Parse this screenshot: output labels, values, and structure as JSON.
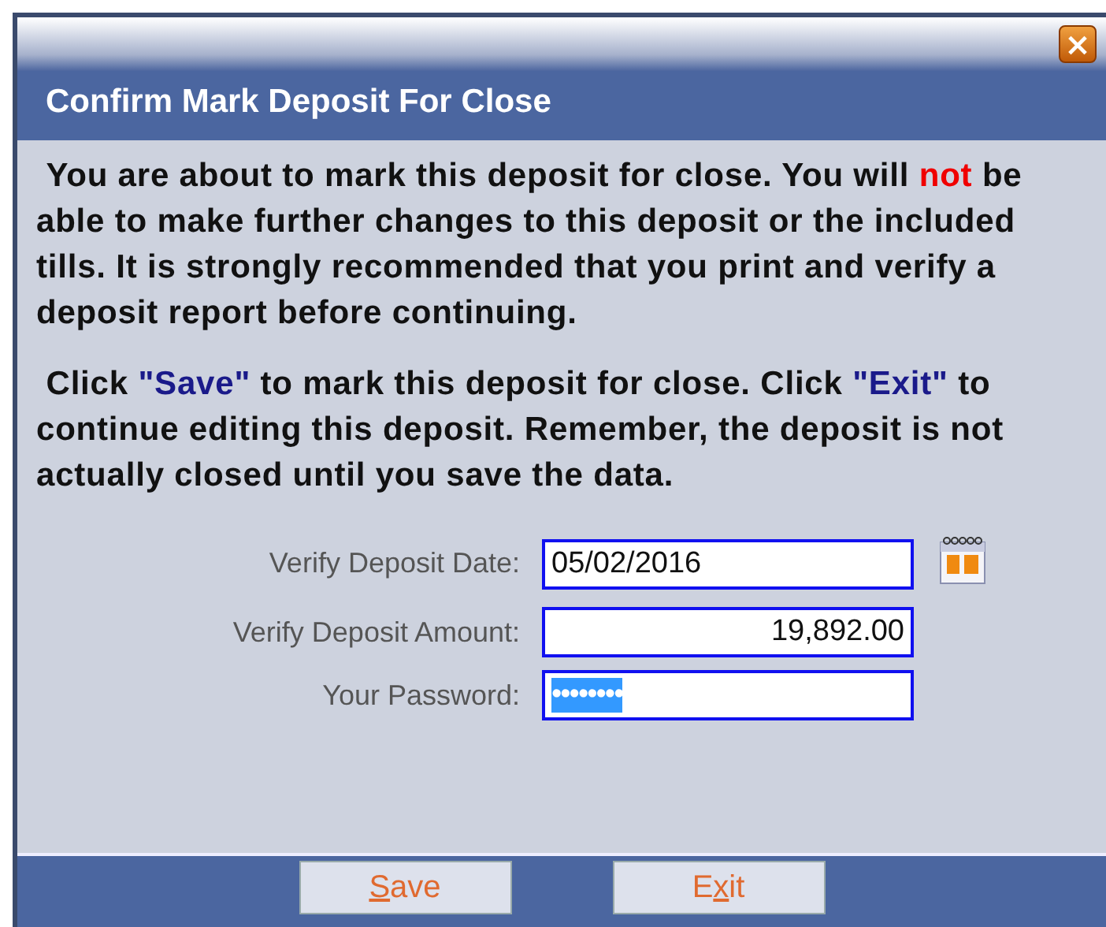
{
  "window": {
    "close_icon": "×"
  },
  "title": "Confirm Mark Deposit For Close",
  "paragraphs": [
    [
      {
        "text": " You are about to mark this deposit for close. You will ",
        "kind": "plain"
      },
      {
        "text": "not",
        "kind": "warning"
      },
      {
        "text": " be able to make further changes to this deposit or the included tills. It is strongly recommended that you print and verify a deposit report before continuing.",
        "kind": "plain"
      }
    ],
    [
      {
        "text": " Click ",
        "kind": "plain"
      },
      {
        "text": "\"Save\"",
        "kind": "emphasis"
      },
      {
        "text": " to mark this deposit for close. Click ",
        "kind": "plain"
      },
      {
        "text": "\"Exit\"",
        "kind": "emphasis"
      },
      {
        "text": " to continue editing this deposit. Remember, the deposit is not actually closed until you save the data.",
        "kind": "plain"
      }
    ]
  ],
  "fields": [
    {
      "label": "Verify Deposit Date:",
      "value": "05/02/2016",
      "kind": "date",
      "value_selected": false
    },
    {
      "label": "Verify Deposit Amount:",
      "value": "19,892.00",
      "kind": "amount",
      "value_selected": false
    },
    {
      "label": "Your Password:",
      "value": "••••••••",
      "kind": "password",
      "value_selected": true
    }
  ],
  "buttons": [
    {
      "key": "S",
      "after": "ave"
    },
    {
      "before": "E",
      "key": "x",
      "after": "it"
    }
  ]
}
